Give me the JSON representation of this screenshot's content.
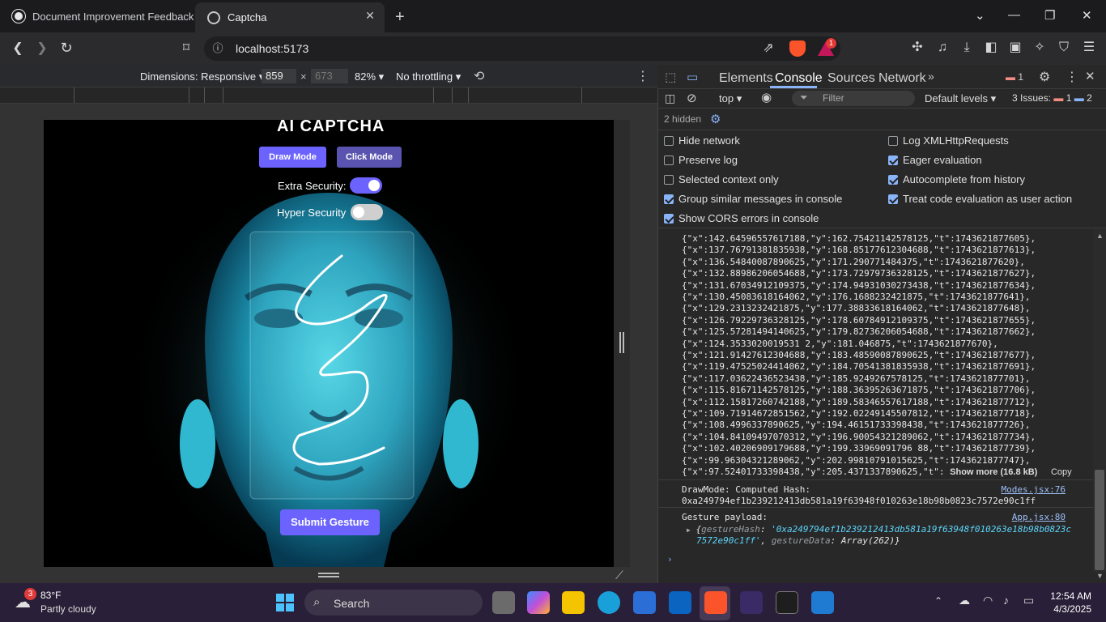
{
  "browser": {
    "tabs": [
      {
        "title": "Document Improvement Feedback"
      },
      {
        "title": "Captcha"
      }
    ],
    "url": "localhost:5173",
    "shield_badge": "1"
  },
  "device_toolbar": {
    "dimensions_label": "Dimensions: Responsive",
    "width": "859",
    "times": "×",
    "height": "673",
    "zoom": "82%",
    "throttling": "No throttling"
  },
  "page": {
    "title": "AI CAPTCHA",
    "draw_mode": "Draw Mode",
    "click_mode": "Click Mode",
    "extra_security_label": "Extra Security:",
    "extra_security_on": true,
    "hyper_security_label": "Hyper Security",
    "hyper_security_on": false,
    "submit_label": "Submit Gesture"
  },
  "devtools": {
    "tabs": [
      "Elements",
      "Console",
      "Sources",
      "Network"
    ],
    "active_tab": "Console",
    "error_badge": "1",
    "context": "top",
    "filter_placeholder": "Filter",
    "levels": "Default levels",
    "issues_label": "3 Issues:",
    "issues_errors": "1",
    "issues_info": "2",
    "hidden_label": "2 hidden",
    "settings": [
      {
        "label": "Hide network",
        "checked": false
      },
      {
        "label": "Log XMLHttpRequests",
        "checked": false
      },
      {
        "label": "Preserve log",
        "checked": false
      },
      {
        "label": "Eager evaluation",
        "checked": true
      },
      {
        "label": "Selected context only",
        "checked": false
      },
      {
        "label": "Autocomplete from history",
        "checked": true
      },
      {
        "label": "Group similar messages in console",
        "checked": true
      },
      {
        "label": "Treat code evaluation as user action",
        "checked": true
      },
      {
        "label": "Show CORS errors in console",
        "checked": true
      }
    ],
    "log_lines": [
      "{\"x\":142.64596557617188,\"y\":162.75421142578125,\"t\":1743621877605},",
      "{\"x\":137.76791381835938,\"y\":168.85177612304688,\"t\":1743621877613},",
      "{\"x\":136.54840087890625,\"y\":171.290771484375,\"t\":1743621877620},",
      "{\"x\":132.88986206054688,\"y\":173.72979736328125,\"t\":1743621877627},",
      "{\"x\":131.67034912109375,\"y\":174.94931030273438,\"t\":1743621877634},",
      "{\"x\":130.45083618164062,\"y\":176.1688232421875,\"t\":1743621877641},",
      "{\"x\":129.2313232421875,\"y\":177.38833618164062,\"t\":1743621877648},",
      "{\"x\":126.79229736328125,\"y\":178.60784912109375,\"t\":1743621877655},",
      "{\"x\":125.57281494140625,\"y\":179.82736206054688,\"t\":1743621877662},",
      "{\"x\":124.3533020019531 2,\"y\":181.046875,\"t\":1743621877670},",
      "{\"x\":121.91427612304688,\"y\":183.48590087890625,\"t\":1743621877677},",
      "{\"x\":119.47525024414062,\"y\":184.70541381835938,\"t\":1743621877691},",
      "{\"x\":117.03622436523438,\"y\":185.9249267578125,\"t\":1743621877701},",
      "{\"x\":115.81671142578125,\"y\":188.36395263671875,\"t\":1743621877706},",
      "{\"x\":112.15817260742188,\"y\":189.58346557617188,\"t\":1743621877712},",
      "{\"x\":109.71914672851562,\"y\":192.02249145507812,\"t\":1743621877718},",
      "{\"x\":108.4996337890625,\"y\":194.46151733398438,\"t\":1743621877726},",
      "{\"x\":104.84109497070312,\"y\":196.90054321289062,\"t\":1743621877734},",
      "{\"x\":102.40206909179688,\"y\":199.33969091796 88,\"t\":1743621877739},",
      "{\"x\":99.96304321289062,\"y\":202.99810791015625,\"t\":1743621877747},"
    ],
    "last_line": "{\"x\":97.52401733398438,\"y\":205.4371337890625,\"t\":",
    "show_more": "Show more (16.8 kB)",
    "copy": "Copy",
    "msg1_label": "DrawMode: Computed Hash:",
    "msg1_link": "Modes.jsx:76",
    "msg1_hash": "0xa249794ef1b239212413db581a19f63948f010263e18b98b0823c7572e90c1ff",
    "msg2_label": "Gesture payload:",
    "msg2_link": "App.jsx:80",
    "msg2_obj_line1_key": "gestureHash",
    "msg2_obj_line1_val": "'0xa249794ef1b239212413db581a19f63948f010263e18b98b0823c",
    "msg2_obj_line2_val": "7572e90c1ff'",
    "msg2_obj_line2_key": "gestureData",
    "msg2_obj_line2_rest": "Array(262)}"
  },
  "taskbar": {
    "weather_temp": "83°F",
    "weather_desc": "Partly cloudy",
    "weather_badge": "3",
    "search_label": "Search",
    "time": "12:54 AM",
    "date": "4/3/2025"
  },
  "colors": {
    "accent_purple": "#6c63ff",
    "console_link": "#9cbef7",
    "devtools_bg": "#282828"
  }
}
